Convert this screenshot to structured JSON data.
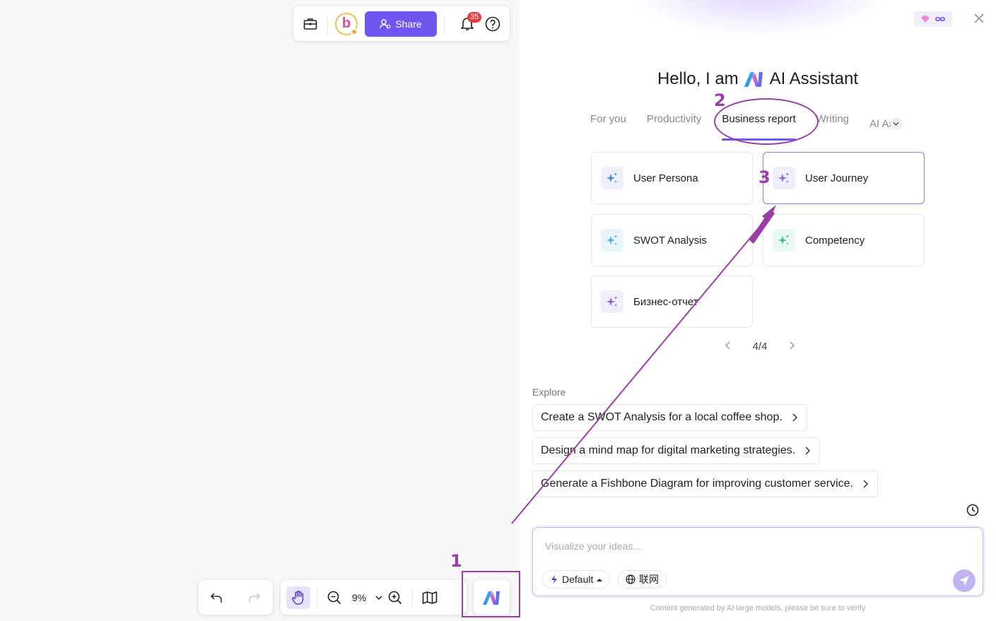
{
  "toolbar": {
    "share_label": "Share",
    "notification_count": "35"
  },
  "bottom_toolbar": {
    "zoom_value": "9%"
  },
  "panel": {
    "hello_prefix": "Hello, I am",
    "hello_suffix": "AI Assistant",
    "tabs": [
      {
        "label": "For you"
      },
      {
        "label": "Productivity"
      },
      {
        "label": "Business report"
      },
      {
        "label": "Writing"
      },
      {
        "label": "AI Ar"
      }
    ],
    "active_tab": "Business report",
    "cards": [
      {
        "label": "User Persona"
      },
      {
        "label": "User Journey"
      },
      {
        "label": "SWOT Analysis"
      },
      {
        "label": "Competency"
      },
      {
        "label": "Бизнес-отчет"
      }
    ],
    "pager": "4/4",
    "explore_title": "Explore",
    "explore_items": [
      {
        "label": "Create a SWOT Analysis for a local coffee shop."
      },
      {
        "label": "Design a mind map for digital marketing strategies."
      },
      {
        "label": "Generate a Fishbone Diagram for improving customer service."
      }
    ],
    "input_placeholder": "Visualize your ideas...",
    "mode_chip": "Default",
    "web_chip": "联网",
    "disclaimer": "Content generated by AI large models, please be sure to verify"
  },
  "annotations": {
    "step1": "1",
    "step2": "2",
    "step3": "3"
  },
  "colors": {
    "accent": "#7155ef",
    "annotation": "#9b3fa8",
    "badge": "#e83b3b"
  }
}
